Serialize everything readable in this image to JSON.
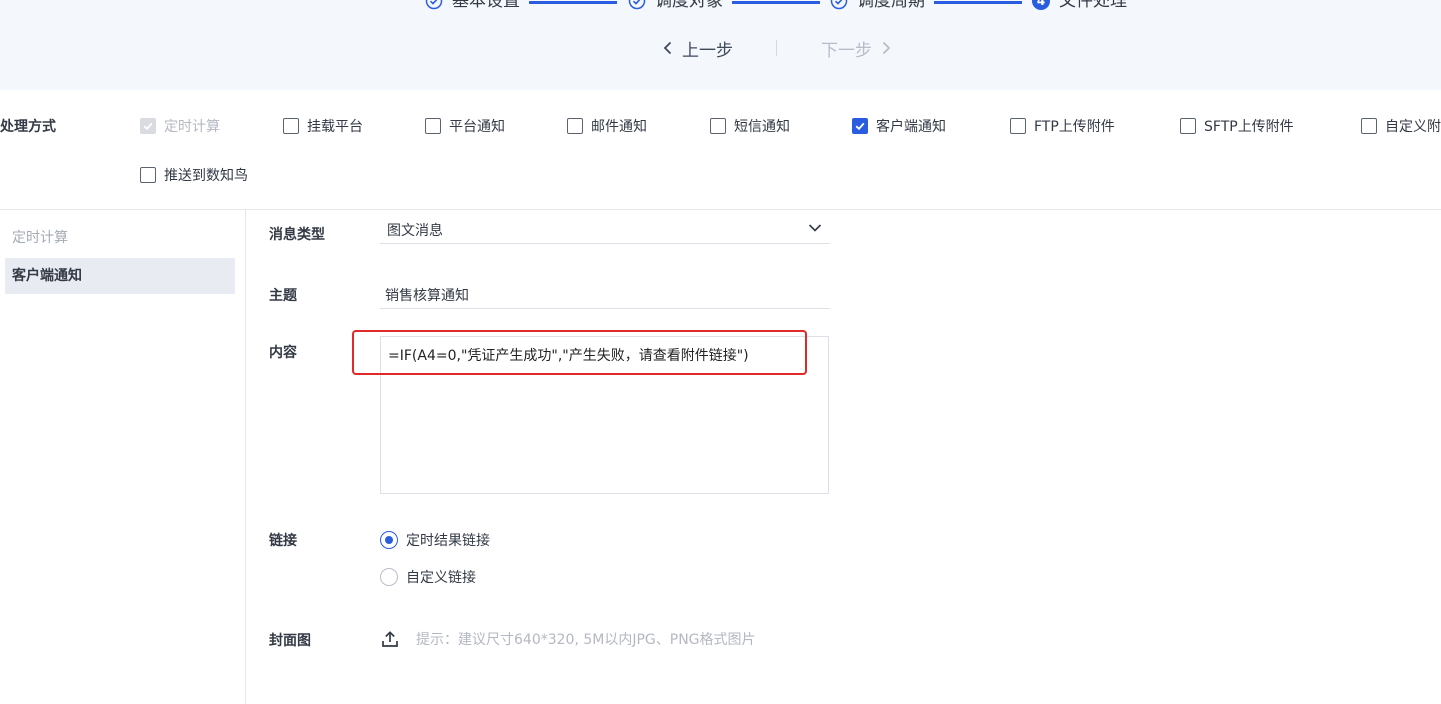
{
  "steps": [
    {
      "label": "基本设置",
      "state": "done"
    },
    {
      "label": "调度对象",
      "state": "done"
    },
    {
      "label": "调度周期",
      "state": "done"
    },
    {
      "label": "文件处理",
      "state": "current",
      "number": "4"
    }
  ],
  "nav": {
    "prev_label": "上一步",
    "next_label": "下一步"
  },
  "method": {
    "label": "处理方式",
    "options": [
      {
        "label": "定时计算",
        "checked": true,
        "disabled": true
      },
      {
        "label": "挂载平台",
        "checked": false
      },
      {
        "label": "平台通知",
        "checked": false
      },
      {
        "label": "邮件通知",
        "checked": false
      },
      {
        "label": "短信通知",
        "checked": false
      },
      {
        "label": "客户端通知",
        "checked": true
      },
      {
        "label": "FTP上传附件",
        "checked": false
      },
      {
        "label": "SFTP上传附件",
        "checked": false
      },
      {
        "label": "自定义附",
        "checked": false
      },
      {
        "label": "推送到数知鸟",
        "checked": false
      }
    ]
  },
  "sidebar": {
    "items": [
      {
        "label": "定时计算"
      },
      {
        "label": "客户端通知",
        "active": true
      }
    ]
  },
  "form": {
    "message_type": {
      "label": "消息类型",
      "value": "图文消息"
    },
    "subject": {
      "label": "主题",
      "value": "销售核算通知"
    },
    "content": {
      "label": "内容",
      "value": "=IF(A4=0,\"凭证产生成功\",\"产生失败，请查看附件链接\")"
    },
    "link": {
      "label": "链接",
      "options": [
        {
          "label": "定时结果链接",
          "selected": true
        },
        {
          "label": "自定义链接",
          "selected": false
        }
      ]
    },
    "cover": {
      "label": "封面图",
      "hint": "提示：建议尺寸640*320, 5M以内JPG、PNG格式图片"
    }
  },
  "colors": {
    "accent": "#2a5ce0",
    "highlight": "#e22929",
    "band": "#f4f7fc"
  }
}
